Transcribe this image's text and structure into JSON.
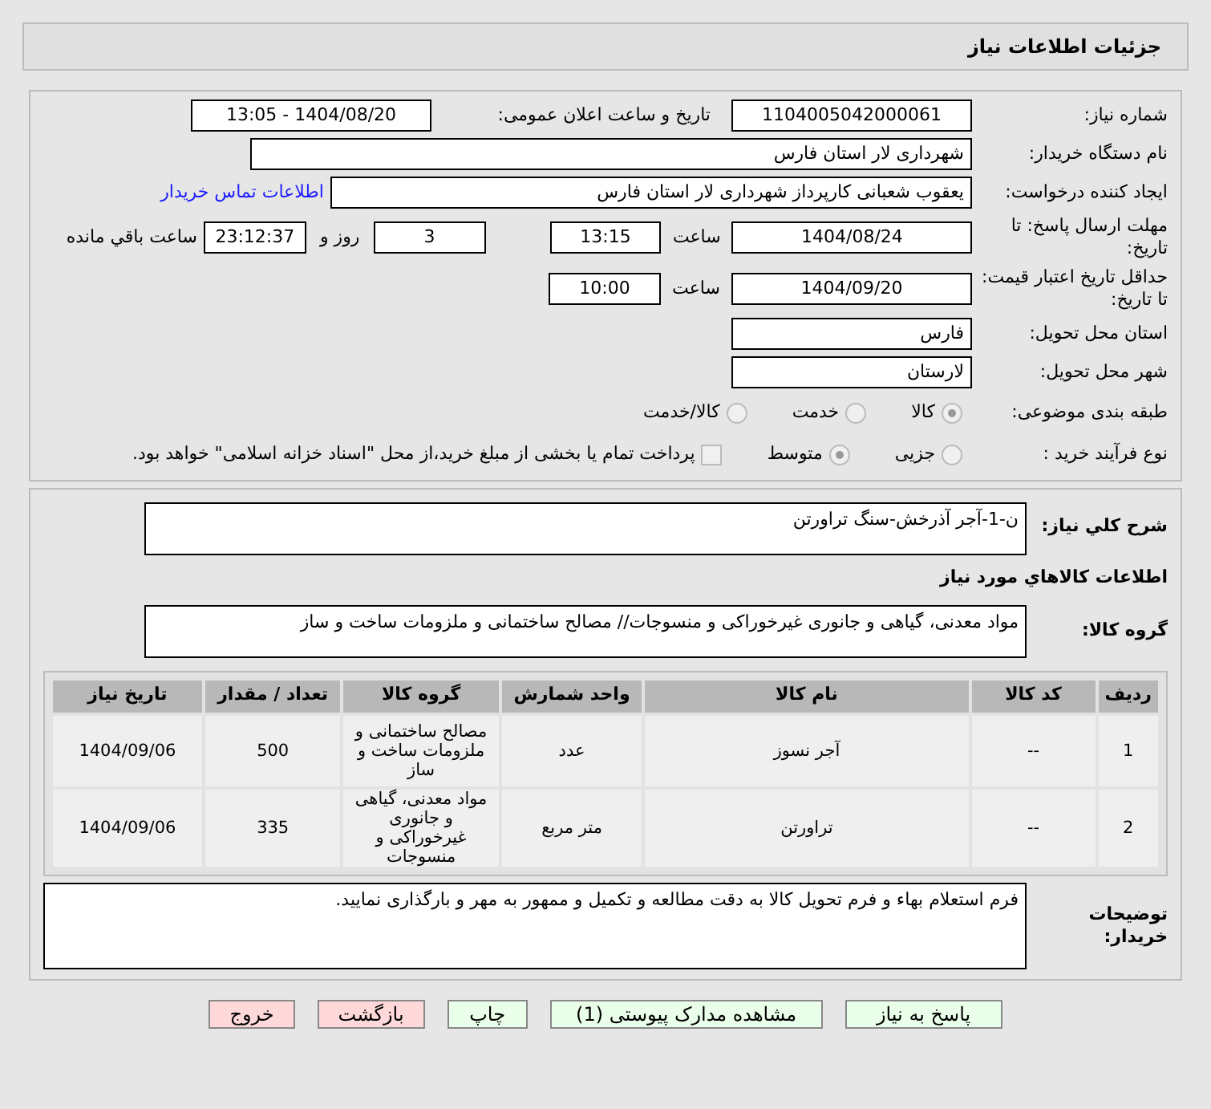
{
  "title": "جزئیات اطلاعات نیاز",
  "need_number": {
    "label": "شماره نیاز:",
    "value": "1104005042000061"
  },
  "announce": {
    "label": "تاریخ و ساعت اعلان عمومی:",
    "value": "1404/08/20 - 13:05"
  },
  "buyer_org": {
    "label": "نام دستگاه خریدار:",
    "value": "شهرداری لار استان فارس"
  },
  "creator": {
    "label": "ایجاد کننده درخواست:",
    "value": "یعقوب شعبانی کارپرداز شهرداری لار استان فارس",
    "link": "اطلاعات تماس خریدار"
  },
  "deadline": {
    "label": "مهلت ارسال پاسخ: تا تاریخ:",
    "date": "1404/08/24",
    "time_label": "ساعت",
    "time": "13:15",
    "days": "3",
    "days_label": "روز و",
    "remaining": "23:12:37",
    "remaining_label": "ساعت باقي مانده"
  },
  "validity": {
    "label": "حداقل تاریخ اعتبار قیمت: تا تاریخ:",
    "date": "1404/09/20",
    "time_label": "ساعت",
    "time": "10:00"
  },
  "province": {
    "label": "استان محل تحویل:",
    "value": "فارس"
  },
  "city": {
    "label": "شهر محل تحویل:",
    "value": "لارستان"
  },
  "category": {
    "label": "طبقه بندی موضوعی:",
    "options": [
      {
        "label": "کالا",
        "selected": true
      },
      {
        "label": "خدمت",
        "selected": false
      },
      {
        "label": "کالا/خدمت",
        "selected": false
      }
    ]
  },
  "process": {
    "label": "نوع فرآیند خرید :",
    "options": [
      {
        "label": "جزیی",
        "selected": false
      },
      {
        "label": "متوسط",
        "selected": true
      }
    ],
    "payment": {
      "label": "پرداخت تمام یا بخشی از مبلغ خرید،از محل \"اسناد خزانه اسلامی\" خواهد بود.",
      "checked": false
    }
  },
  "description": {
    "label": "شرح کلي نياز:",
    "value": "ن-1-آجر آذرخش-سنگ تراورتن"
  },
  "goods_heading": "اطلاعات کالاهاي مورد نياز",
  "goods_group": {
    "label": "گروه کالا:",
    "value": "مواد معدنی، گیاهی و جانوری غیرخوراکی و منسوجات// مصالح ساختمانی و ملزومات ساخت و ساز"
  },
  "table": {
    "columns": [
      "ردیف",
      "کد کالا",
      "نام کالا",
      "واحد شمارش",
      "گروه کالا",
      "تعداد / مقدار",
      "تاریخ نیاز"
    ],
    "rows": [
      [
        "1",
        "--",
        "آجر نسوز",
        "عدد",
        "مصالح ساختمانی و ملزومات ساخت و ساز",
        "500",
        "1404/09/06"
      ],
      [
        "2",
        "--",
        "تراورتن",
        "متر مربع",
        "مواد معدنی، گیاهی و جانوری غیرخوراکی و منسوجات",
        "335",
        "1404/09/06"
      ]
    ]
  },
  "buyer_notes": {
    "label": "توضیحات خریدار:",
    "value": "فرم استعلام بهاء و فرم تحویل کالا به دقت مطالعه و تکمیل و ممهور به مهر و بارگذاری نمایید."
  },
  "buttons": [
    {
      "label": "پاسخ به نیاز",
      "kind": "normal"
    },
    {
      "label": "مشاهده مدارک پیوستی (1)",
      "kind": "normal"
    },
    {
      "label": "چاپ",
      "kind": "normal"
    },
    {
      "label": "بازگشت",
      "kind": "danger"
    },
    {
      "label": "خروج",
      "kind": "danger"
    }
  ]
}
